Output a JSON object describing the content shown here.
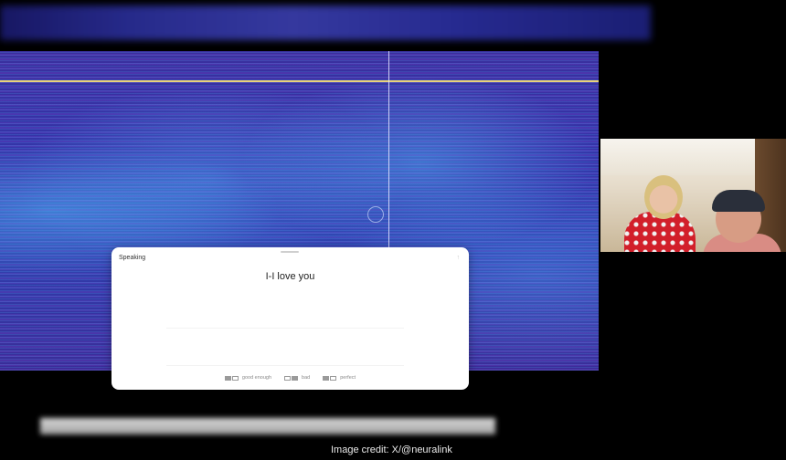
{
  "card": {
    "title": "Speaking",
    "transcript": "I-I love you",
    "corner_glyph": "↑"
  },
  "rating": {
    "options": [
      {
        "label": "good enough",
        "icon": "two-box-half-icon"
      },
      {
        "label": "bad",
        "icon": "two-box-right-icon"
      },
      {
        "label": "perfect",
        "icon": "two-box-left-icon"
      }
    ]
  },
  "credit": "Image credit: X/@neuralink",
  "colors": {
    "spectrogram": "#3434a8",
    "marker_line": "#e8d27a",
    "card_bg": "#ffffff"
  }
}
